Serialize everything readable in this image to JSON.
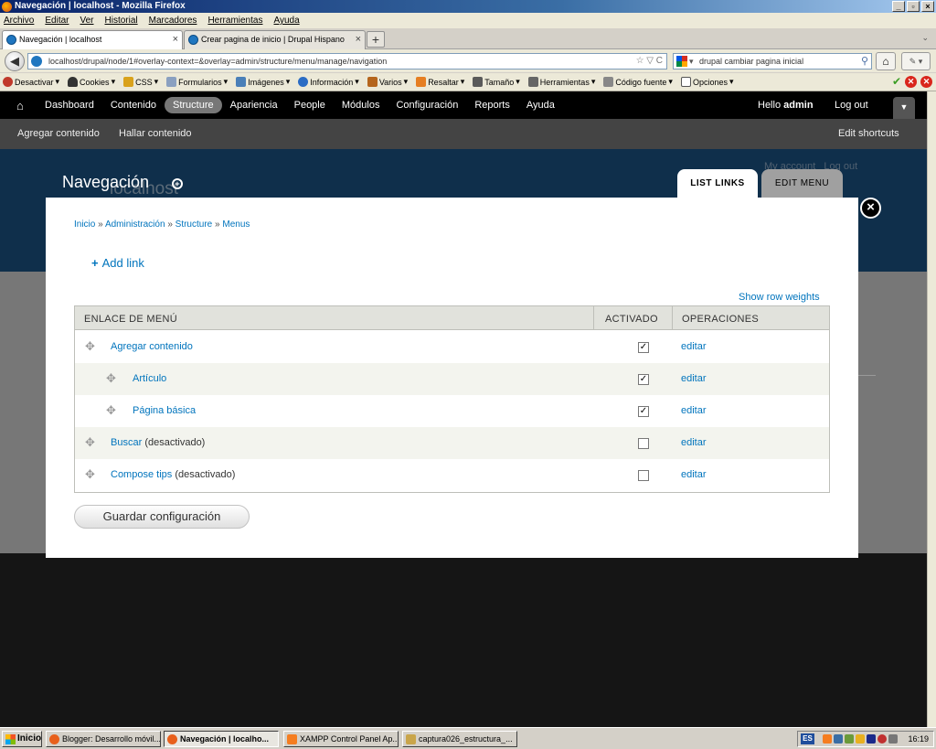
{
  "window": {
    "title": "Navegación | localhost - Mozilla Firefox"
  },
  "menubar": [
    "Archivo",
    "Editar",
    "Ver",
    "Historial",
    "Marcadores",
    "Herramientas",
    "Ayuda"
  ],
  "tabs": [
    {
      "title": "Navegación | localhost",
      "active": true
    },
    {
      "title": "Crear pagina de inicio | Drupal Hispano",
      "active": false
    }
  ],
  "navbar": {
    "url": "localhost/drupal/node/1#overlay-context=&overlay=admin/structure/menu/manage/navigation",
    "search_value": "drupal cambiar pagina inicial"
  },
  "devbar": {
    "items": [
      "Desactivar",
      "Cookies",
      "CSS",
      "Formularios",
      "Imágenes",
      "Información",
      "Varios",
      "Resaltar",
      "Tamaño",
      "Herramientas",
      "Código fuente",
      "Opciones"
    ]
  },
  "toolbar": {
    "items": [
      "Dashboard",
      "Contenido",
      "Structure",
      "Apariencia",
      "People",
      "Módulos",
      "Configuración",
      "Reports",
      "Ayuda"
    ],
    "active": "Structure",
    "hello": "Hello",
    "username": "admin",
    "logout": "Log out"
  },
  "shortcuts": {
    "add_content": "Agregar contenido",
    "find_content": "Hallar contenido",
    "edit": "Edit shortcuts"
  },
  "background": {
    "site_name": "localhost",
    "my_account": "My account",
    "log_out": "Log out"
  },
  "overlay": {
    "title": "Navegación",
    "tab_list": "LIST LINKS",
    "tab_edit": "EDIT MENU",
    "breadcrumb": [
      "Inicio",
      "Administración",
      "Structure",
      "Menus"
    ],
    "breadcrumb_sep": "»",
    "add_link": "Add link",
    "show_row_weights": "Show row weights",
    "table": {
      "headers": [
        "ENLACE DE MENÚ",
        "ACTIVADO",
        "OPERACIONES"
      ],
      "rows": [
        {
          "label": "Agregar contenido",
          "suffix": "",
          "enabled": true,
          "op": "editar",
          "indent": 0
        },
        {
          "label": "Artículo",
          "suffix": "",
          "enabled": true,
          "op": "editar",
          "indent": 1
        },
        {
          "label": "Página básica",
          "suffix": "",
          "enabled": true,
          "op": "editar",
          "indent": 1
        },
        {
          "label": "Buscar",
          "suffix": "(desactivado)",
          "enabled": false,
          "op": "editar",
          "indent": 0
        },
        {
          "label": "Compose tips",
          "suffix": "(desactivado)",
          "enabled": false,
          "op": "editar",
          "indent": 0
        }
      ]
    },
    "save_button": "Guardar configuración"
  },
  "taskbar": {
    "start": "Inicio",
    "tasks": [
      {
        "title": "Blogger: Desarrollo móvil...",
        "active": false
      },
      {
        "title": "Navegación | localho...",
        "active": true
      },
      {
        "title": "XAMPP Control Panel Ap...",
        "active": false
      },
      {
        "title": "captura026_estructura_...",
        "active": false
      }
    ],
    "lang": "ES",
    "clock": "16:19"
  }
}
